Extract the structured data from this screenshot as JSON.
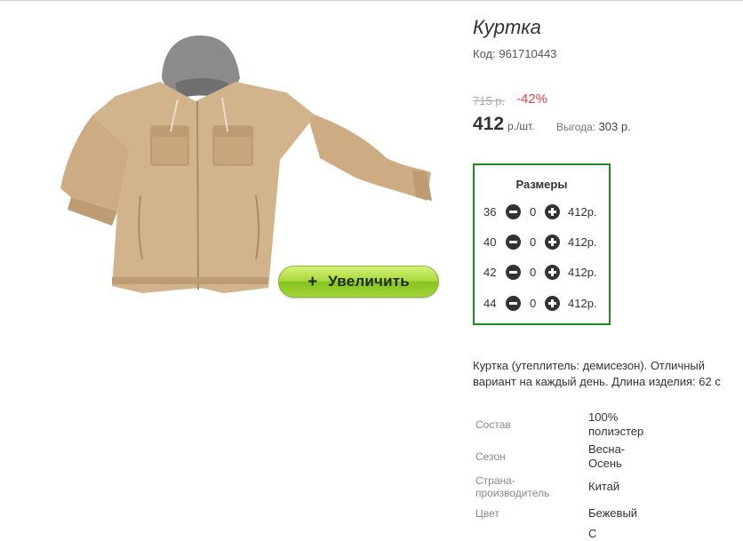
{
  "product": {
    "title": "Куртка",
    "code_label": "Код:",
    "code": "961710443",
    "old_price": "715 р.",
    "discount": "-42%",
    "price": "412",
    "price_unit": "р./шт.",
    "benefit_label": "Выгода:",
    "benefit_value": "303 р."
  },
  "image": {
    "zoom_plus": "+",
    "zoom_label": "Увеличить"
  },
  "sizes": {
    "title": "Размеры",
    "rows": [
      {
        "size": "36",
        "qty": "0",
        "price": "412р."
      },
      {
        "size": "40",
        "qty": "0",
        "price": "412р."
      },
      {
        "size": "42",
        "qty": "0",
        "price": "412р."
      },
      {
        "size": "44",
        "qty": "0",
        "price": "412р."
      }
    ]
  },
  "description": {
    "line1": "Куртка (утеплитель: демисезон). Отличный",
    "line2": "вариант на каждый день. Длина изделия: 62 с"
  },
  "attributes": [
    {
      "label_line1": "Состав",
      "label_line2": "",
      "value_line1": "100%",
      "value_line2": "полиэстер"
    },
    {
      "label_line1": "Сезон",
      "label_line2": "",
      "value_line1": "Весна-",
      "value_line2": "Осень"
    },
    {
      "label_line1": "Страна-",
      "label_line2": "производитель",
      "value_line1": "Китай",
      "value_line2": ""
    },
    {
      "label_line1": "Цвет",
      "label_line2": "",
      "value_line1": "Бежевый",
      "value_line2": ""
    },
    {
      "label_line1": "",
      "label_line2": "",
      "value_line1": "С",
      "value_line2": ""
    }
  ],
  "colors": {
    "sizes_border": "#1f8b1f",
    "discount": "#e0434d",
    "zoom_button": "#a7d93a",
    "jacket_body": "#d2b48c",
    "hood": "#8a8a8a"
  }
}
